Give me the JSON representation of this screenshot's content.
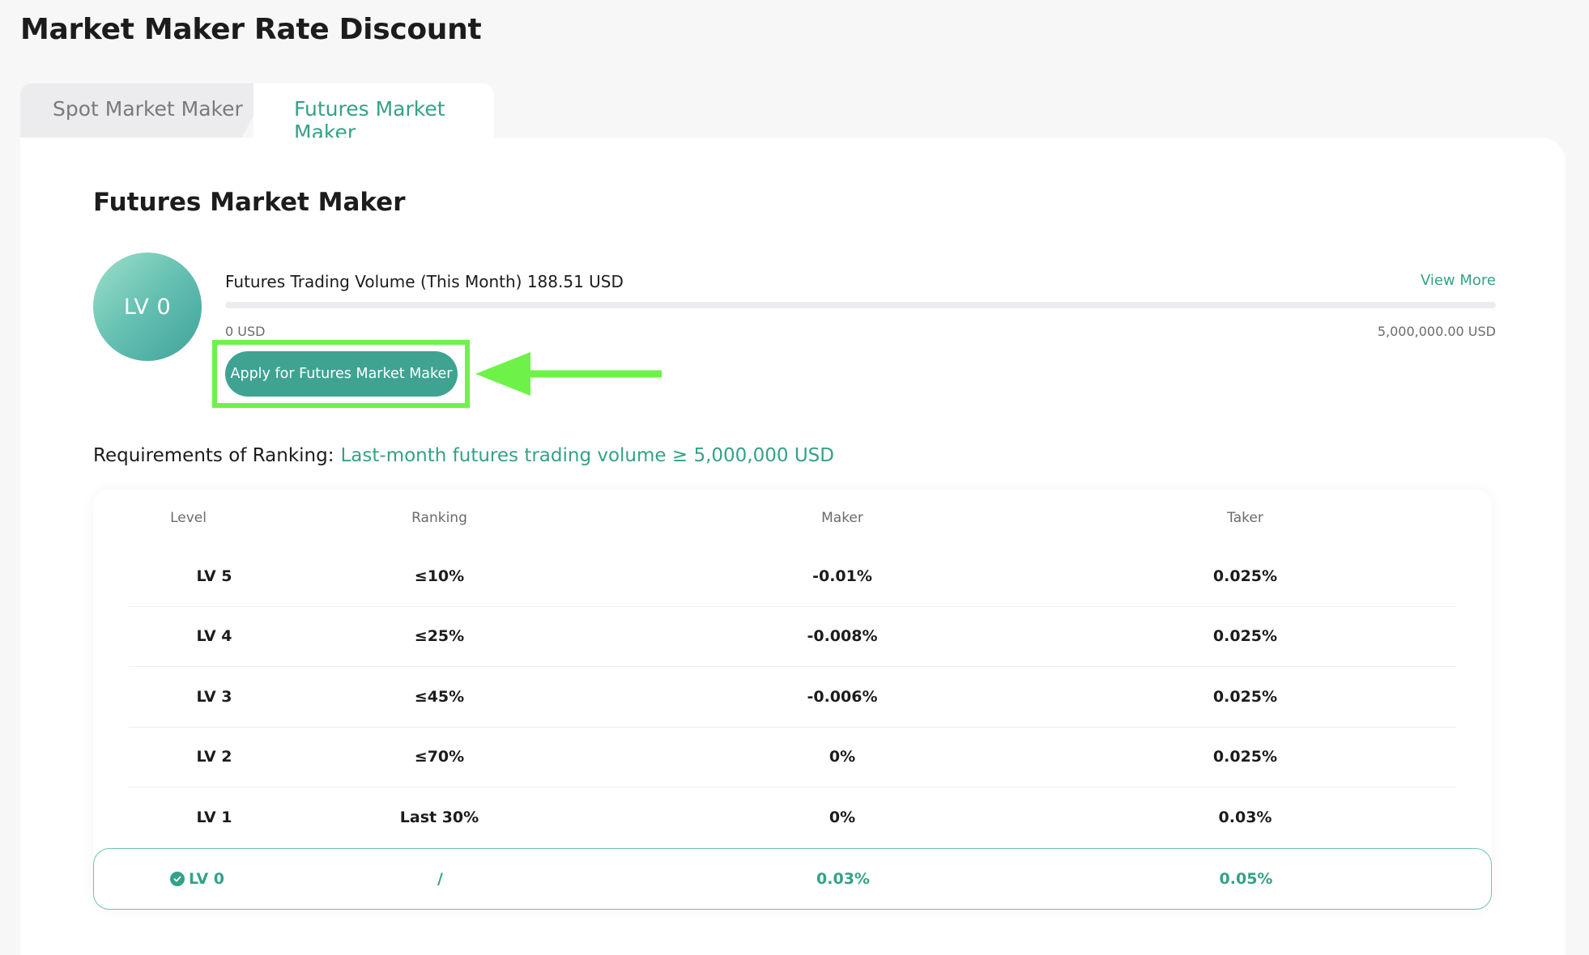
{
  "page": {
    "title": "Market Maker Rate Discount"
  },
  "tabs": [
    {
      "label": "Spot Market Maker",
      "active": false
    },
    {
      "label": "Futures Market Maker",
      "active": true
    }
  ],
  "section": {
    "title": "Futures Market Maker",
    "level_badge": "LV 0",
    "volume_label": "Futures Trading Volume (This Month) 188.51 USD",
    "view_more": "View More",
    "progress": {
      "value": 188.51,
      "max": 5000000,
      "min_label": "0 USD",
      "max_label": "5,000,000.00 USD"
    },
    "apply_button": "Apply for Futures Market Maker"
  },
  "requirements": {
    "label": "Requirements of Ranking:",
    "value": "Last-month futures trading volume ≥ 5,000,000 USD"
  },
  "table": {
    "headers": [
      "Level",
      "Ranking",
      "Maker",
      "Taker"
    ],
    "rows": [
      {
        "level": "LV 5",
        "ranking": "≤10%",
        "maker": "-0.01%",
        "taker": "0.025%"
      },
      {
        "level": "LV 4",
        "ranking": "≤25%",
        "maker": "-0.008%",
        "taker": "0.025%"
      },
      {
        "level": "LV 3",
        "ranking": "≤45%",
        "maker": "-0.006%",
        "taker": "0.025%"
      },
      {
        "level": "LV 2",
        "ranking": "≤70%",
        "maker": "0%",
        "taker": "0.025%"
      },
      {
        "level": "LV 1",
        "ranking": "Last 30%",
        "maker": "0%",
        "taker": "0.03%"
      }
    ],
    "current_row": {
      "level": "LV 0",
      "ranking": "/",
      "maker": "0.03%",
      "taker": "0.05%"
    }
  },
  "colors": {
    "accent": "#35a189",
    "annotation": "#6ef24a"
  }
}
